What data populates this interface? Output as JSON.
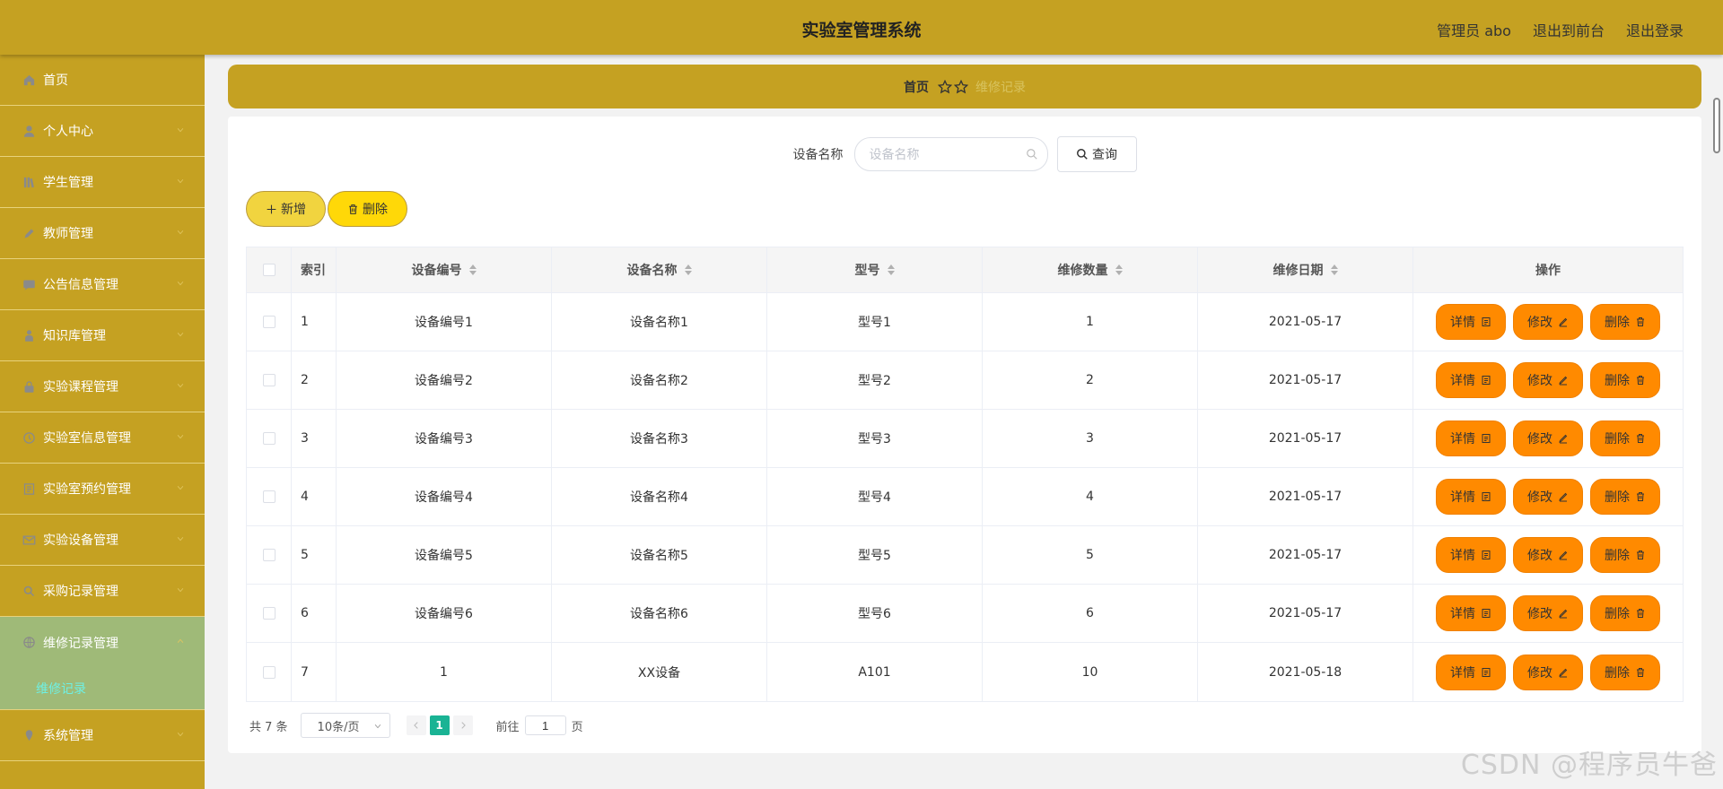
{
  "header": {
    "title": "实验室管理系统",
    "links": [
      "管理员 abo",
      "退出到前台",
      "退出登录"
    ]
  },
  "sidebar": {
    "items": [
      {
        "label": "首页",
        "icon": "home-icon",
        "has_children": false
      },
      {
        "label": "个人中心",
        "icon": "user-icon",
        "has_children": true
      },
      {
        "label": "学生管理",
        "icon": "books-icon",
        "has_children": true
      },
      {
        "label": "教师管理",
        "icon": "pen-icon",
        "has_children": true
      },
      {
        "label": "公告信息管理",
        "icon": "message-icon",
        "has_children": true
      },
      {
        "label": "知识库管理",
        "icon": "person-icon",
        "has_children": true
      },
      {
        "label": "实验课程管理",
        "icon": "lock-icon",
        "has_children": true
      },
      {
        "label": "实验室信息管理",
        "icon": "clock-icon",
        "has_children": true
      },
      {
        "label": "实验室预约管理",
        "icon": "document-icon",
        "has_children": true
      },
      {
        "label": "实验设备管理",
        "icon": "mail-icon",
        "has_children": true
      },
      {
        "label": "采购记录管理",
        "icon": "search-icon",
        "has_children": true
      },
      {
        "label": "维修记录管理",
        "icon": "globe-icon",
        "has_children": true,
        "open": true
      }
    ],
    "sub_item": "维修记录",
    "after_items": [
      {
        "label": "系统管理",
        "icon": "pin-icon",
        "has_children": true
      }
    ]
  },
  "breadcrumb": {
    "home": "首页",
    "current": "维修记录"
  },
  "search": {
    "label": "设备名称",
    "placeholder": "设备名称",
    "query_label": "查询"
  },
  "actions": {
    "add_label": "新增",
    "delete_label": "删除"
  },
  "table": {
    "columns": [
      "索引",
      "设备编号",
      "设备名称",
      "型号",
      "维修数量",
      "维修日期",
      "操作"
    ],
    "rows": [
      [
        "1",
        "设备编号1",
        "设备名称1",
        "型号1",
        "1",
        "2021-05-17"
      ],
      [
        "2",
        "设备编号2",
        "设备名称2",
        "型号2",
        "2",
        "2021-05-17"
      ],
      [
        "3",
        "设备编号3",
        "设备名称3",
        "型号3",
        "3",
        "2021-05-17"
      ],
      [
        "4",
        "设备编号4",
        "设备名称4",
        "型号4",
        "4",
        "2021-05-17"
      ],
      [
        "5",
        "设备编号5",
        "设备名称5",
        "型号5",
        "5",
        "2021-05-17"
      ],
      [
        "6",
        "设备编号6",
        "设备名称6",
        "型号6",
        "6",
        "2021-05-17"
      ],
      [
        "7",
        "1",
        "XX设备",
        "A101",
        "10",
        "2021-05-18"
      ]
    ],
    "row_actions": [
      "详情",
      "修改",
      "删除"
    ]
  },
  "pager": {
    "total": "共 7 条",
    "page_size": "10条/页",
    "current_page": "1",
    "goto_label": "前往",
    "goto_value": "1",
    "page_suffix": "页"
  },
  "watermark": "CSDN @程序员牛爸",
  "colors": {
    "primary": "#c5a122",
    "menu_open": "#9fba78",
    "submenu_text": "#6ff0e3",
    "row_action": "#ff8a00",
    "pager_active": "#1ab394"
  }
}
